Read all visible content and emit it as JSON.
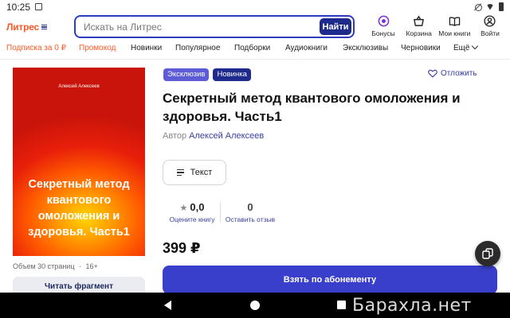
{
  "status_bar": {
    "time": "10:25"
  },
  "header": {
    "logo": "Литрес",
    "search": {
      "placeholder": "Искать на Литрес",
      "value": ""
    },
    "search_button": "Найти",
    "actions": [
      {
        "icon": "bonus-icon",
        "label": "Бонусы"
      },
      {
        "icon": "basket-icon",
        "label": "Корзина"
      },
      {
        "icon": "book-icon",
        "label": "Мои книги"
      },
      {
        "icon": "user-icon",
        "label": "Войти"
      }
    ]
  },
  "nav": {
    "items": [
      "Подписка за 0 ₽",
      "Промокод",
      "Новинки",
      "Популярное",
      "Подборки",
      "Аудиокниги",
      "Эксклюзивы",
      "Черновики",
      "Ещё"
    ],
    "accent_color": "#ff5a27"
  },
  "book": {
    "cover_author": "Алексей Алексеев",
    "cover_title": "Секретный метод квантового омоложения и здоровья. Часть1",
    "volume": "Объем 30 страниц",
    "age": "16+",
    "read_fragment": "Читать фрагмент",
    "badges": [
      "Эксклюзив",
      "Новинка"
    ],
    "postpone": "Отложить",
    "title": "Секретный метод квантового омоложения и здоровья. Часть1",
    "author_prefix": "Автор",
    "author": "Алексей Алексеев",
    "format": "Текст",
    "rating_value": "0,0",
    "rating_link": "Оцените книгу",
    "reviews_count": "0",
    "reviews_link": "Оставить отзыв",
    "price": "399 ₽",
    "subscribe_button": "Взять по абонементу"
  },
  "watermark": "Барахла.нет",
  "colors": {
    "primary": "#3a3fcb",
    "dark_blue": "#1e2a8c",
    "badge_exclusive": "#5d5bd6",
    "link": "#3a3fa3"
  }
}
